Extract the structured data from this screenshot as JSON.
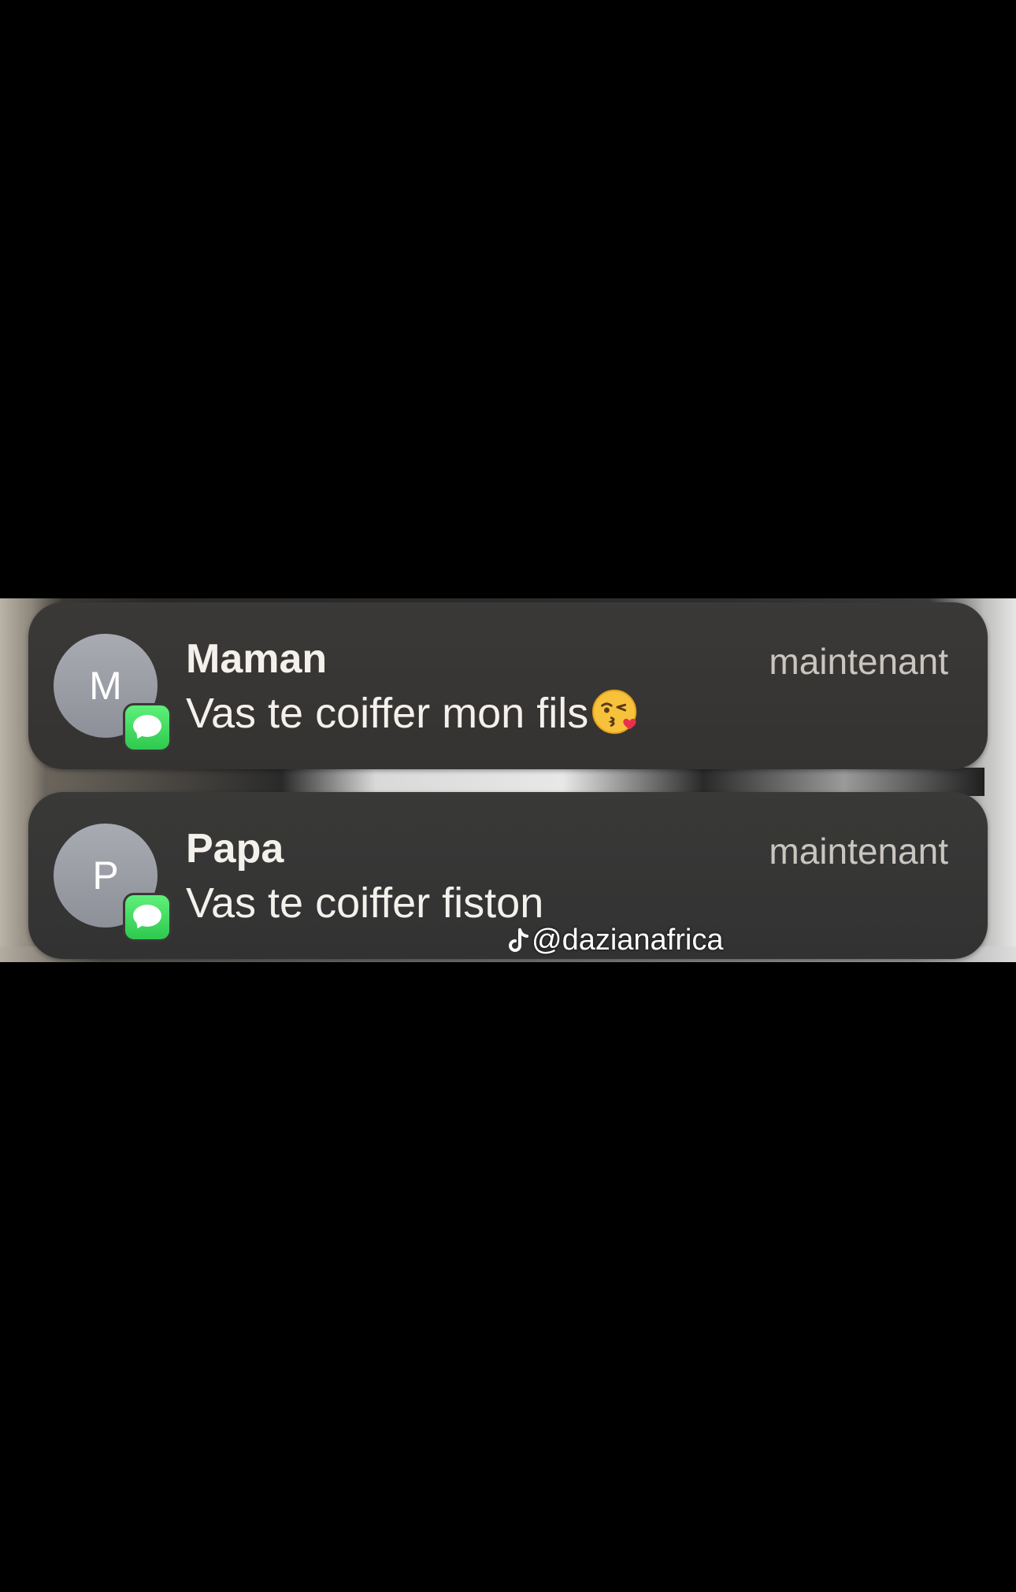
{
  "notifications": [
    {
      "avatar_initial": "M",
      "sender": "Maman",
      "time": "maintenant",
      "message": "Vas te coiffer mon fils",
      "emoji": "kissing-face-with-heart-icon",
      "app_icon": "messages-icon"
    },
    {
      "avatar_initial": "P",
      "sender": "Papa",
      "time": "maintenant",
      "message": "Vas te coiffer fiston",
      "app_icon": "messages-icon"
    }
  ],
  "watermark": {
    "icon": "tiktok-icon",
    "text": "@dazianafrica"
  },
  "colors": {
    "badge_green": "#34c759",
    "card_bg": "#383634",
    "text_primary": "#f4f1ec",
    "text_secondary": "#c9c5bf"
  }
}
